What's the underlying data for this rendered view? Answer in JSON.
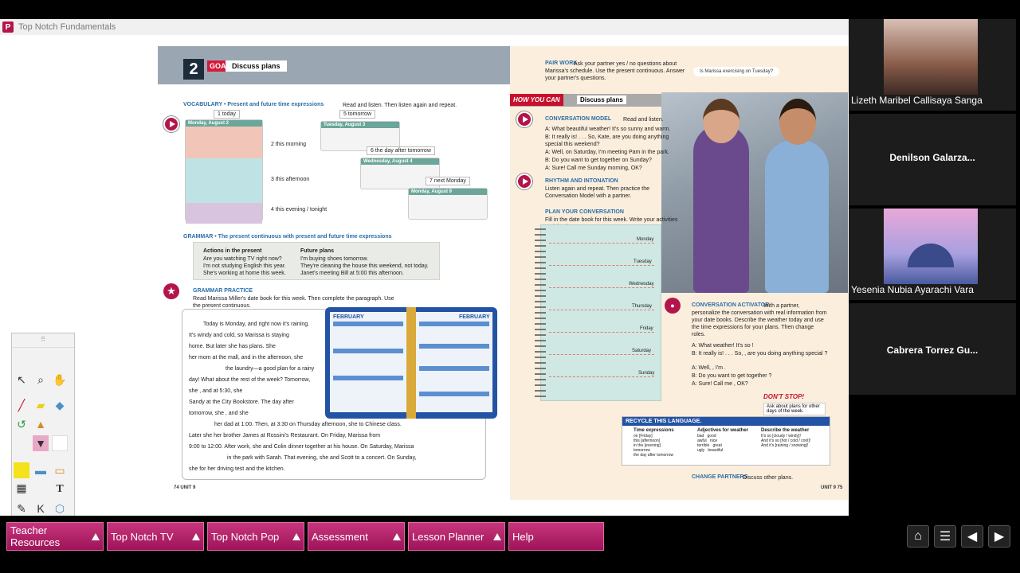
{
  "window": {
    "title": "Top Notch Fundamentals"
  },
  "book": {
    "lesson_label": "2",
    "goal_badge": "GOAL",
    "goal_title": "Discuss plans",
    "vocab_heading": "VOCABULARY • Present and future time expressions",
    "vocab_instruction": "Read and listen. Then listen again and repeat.",
    "time_tags": [
      "1 today",
      "2 this morning",
      "3 this afternoon",
      "4 this evening / tonight",
      "5 tomorrow",
      "6 the day after tomorrow",
      "7 next Monday"
    ],
    "grammar_heading": "GRAMMAR • The present continuous with present and future time expressions",
    "grammar_col1_title": "Actions in the present",
    "grammar_col1_lines": [
      "Are you watching TV right now?",
      "I'm not studying English this year.",
      "She's working at home this week."
    ],
    "grammar_col2_title": "Future plans",
    "grammar_col2_lines": [
      "I'm buying shoes tomorrow.",
      "They're cleaning the house this weekend, not today.",
      "Janet's meeting Bill at 5:00 this afternoon."
    ],
    "practice_heading": "GRAMMAR PRACTICE",
    "practice_instruction": "Read Marissa Miller's date book for this week. Then complete the paragraph. Use the present continuous.",
    "paragraph_lines": [
      "Today is Monday, and right now it's raining.",
      "It's windy and cold, so Marissa  is staying",
      "home. But later she has plans. She",
      "her mom at the mall, and in the afternoon, she",
      "the laundry—a good plan for a rainy",
      "day! What about the rest of the week? Tomorrow,",
      "she            , and at 5:30, she",
      "Sandy at the City Bookstore. The day after",
      "tomorrow, she              , and she",
      "her dad at 1:00. Then, at 3:30 on Thursday afternoon, she              to Chinese class.",
      "Later she              her brother James at Rossini's Restaurant. On Friday, Marissa              from",
      "9:00 to 12:00. After work, she and Colin              dinner together at his house. On Saturday, Marissa",
      "in the park with Sarah. That evening, she and Scott              to a concert. On Sunday,",
      "she              for her driving test and              the kitchen."
    ],
    "datebook_header": "FEBRUARY",
    "page_left_num": "74  UNIT 9",
    "page_right_num": "UNIT 9  75",
    "pair_work_heading": "PAIR WORK",
    "pair_work_text": "Ask your partner yes / no questions about Marissa's schedule. Use the present continuous. Answer your partner's questions.",
    "pair_work_quote": "Is Marissa exercising on Tuesday?",
    "how_you_can_badge": "HOW YOU CAN",
    "how_you_can_title": "Discuss plans",
    "conv_model_heading": "CONVERSATION MODEL",
    "conv_model_instr": "Read and listen.",
    "conv_model_lines": [
      "A: What beautiful weather! It's so sunny and warm.",
      "B: It really is! . . . So, Kate, are you doing anything special this weekend?",
      "A: Well, on Saturday, I'm meeting Pam in the park.",
      "B: Do you want to get together on Sunday?",
      "A: Sure! Call me Sunday morning, OK?"
    ],
    "rhythm_heading": "RHYTHM AND INTONATION",
    "rhythm_text": "Listen again and repeat. Then practice the Conversation Model with a partner.",
    "plan_heading": "PLAN YOUR CONVERSATION",
    "plan_text": "Fill in the date book for this week. Write your activities and the times.",
    "notebook_days": [
      "Monday",
      "Tuesday",
      "Wednesday",
      "Thursday",
      "Friday",
      "Saturday",
      "Sunday"
    ],
    "activator_heading": "CONVERSATION ACTIVATOR",
    "activator_text": "With a partner, personalize the conversation with real information from your date books. Describe the weather today and use the time expressions for your plans. Then change roles.",
    "activator_lines": [
      "A: What          weather! It's so          !",
      "B: It really is! . . . So,          , are you doing anything special          ?",
      "A: Well,          , I'm          .",
      "B: Do you want to get together          ?",
      "A: Sure! Call me          , OK?"
    ],
    "dont_stop": "DON'T STOP!",
    "dont_stop_note": "Ask about plans for other days of the week.",
    "recycle_heading": "RECYCLE THIS LANGUAGE.",
    "recycle_col1_title": "Time expressions",
    "recycle_col1": [
      "on [Friday]",
      "this [afternoon]",
      "in the [evening]",
      "tomorrow",
      "the day after tomorrow"
    ],
    "recycle_col2_title": "Adjectives for weather",
    "recycle_col2": [
      "bad   good",
      "awful   nice",
      "terrible   great",
      "ugly   beautiful"
    ],
    "recycle_col3_title": "Describe the weather",
    "recycle_col3": [
      "It's so [cloudy / windy]!",
      "And it's so [hot / cold / cool]!",
      "And it's [raining / snowing]!"
    ],
    "change_partners": "CHANGE PARTNERS",
    "change_partners_text": "Discuss other plans."
  },
  "participants": [
    {
      "name": "Lizeth Maribel Callisaya Sanga",
      "has_video": true
    },
    {
      "name": "Denilson  Galarza...",
      "has_video": false
    },
    {
      "name": "Yesenia Nubia Ayarachi Vara",
      "has_video": true
    },
    {
      "name": "Cabrera  Torrez  Gu...",
      "has_video": false
    }
  ],
  "bottom_nav": [
    {
      "label": "Teacher Resources"
    },
    {
      "label": "Top Notch TV"
    },
    {
      "label": "Top Notch Pop"
    },
    {
      "label": "Assessment"
    },
    {
      "label": "Lesson Planner"
    },
    {
      "label": "Help"
    }
  ],
  "icons": {
    "app": "app-logo-icon",
    "home": "home-icon",
    "menu": "list-menu-icon",
    "prev": "previous-page-icon",
    "next": "next-page-icon"
  },
  "colors": {
    "accent": "#b3154b",
    "nav": "#c7357d"
  }
}
